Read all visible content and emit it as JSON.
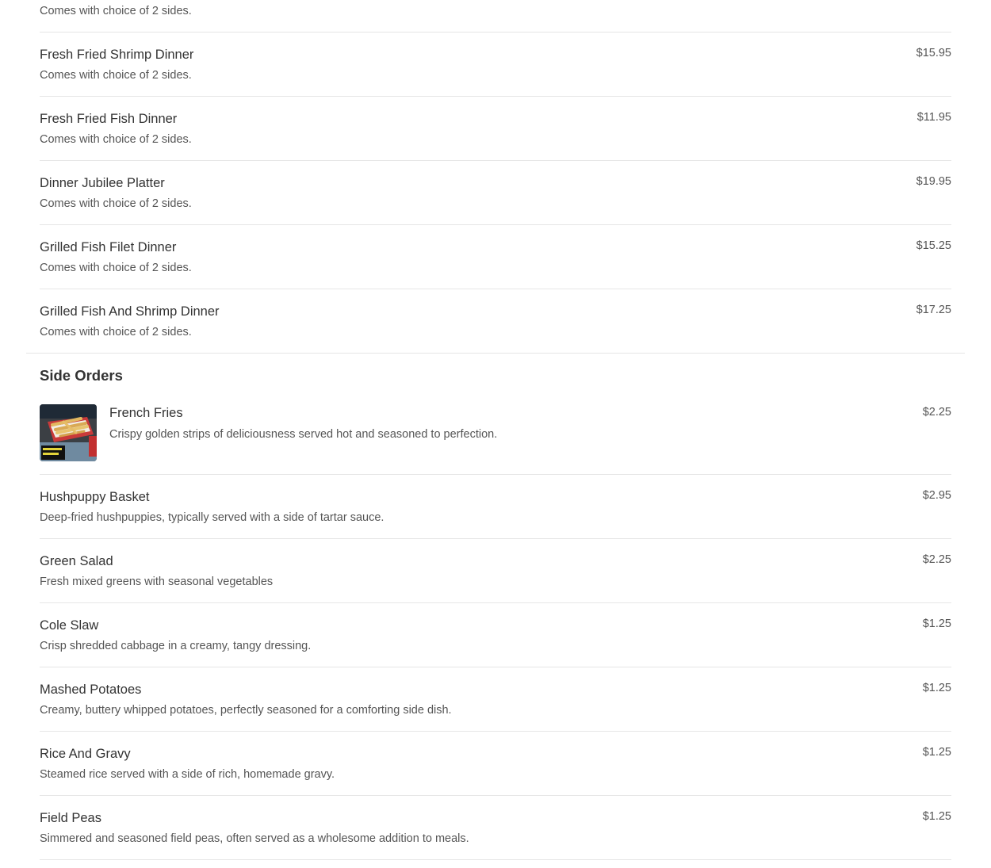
{
  "partial_item": {
    "description": "Comes with choice of 2 sides."
  },
  "dinners": [
    {
      "name": "Fresh Fried Shrimp Dinner",
      "description": "Comes with choice of 2 sides.",
      "price": "$15.95"
    },
    {
      "name": "Fresh Fried Fish Dinner",
      "description": "Comes with choice of 2 sides.",
      "price": "$11.95"
    },
    {
      "name": "Dinner Jubilee Platter",
      "description": "Comes with choice of 2 sides.",
      "price": "$19.95"
    },
    {
      "name": "Grilled Fish Filet Dinner",
      "description": "Comes with choice of 2 sides.",
      "price": "$15.25"
    },
    {
      "name": "Grilled Fish And Shrimp Dinner",
      "description": "Comes with choice of 2 sides.",
      "price": "$17.25"
    }
  ],
  "side_orders": {
    "title": "Side Orders",
    "featured": {
      "name": "French Fries",
      "description": "Crispy golden strips of deliciousness served hot and seasoned to perfection.",
      "price": "$2.25"
    },
    "items": [
      {
        "name": "Hushpuppy Basket",
        "description": "Deep-fried hushpuppies, typically served with a side of tartar sauce.",
        "price": "$2.95"
      },
      {
        "name": "Green Salad",
        "description": "Fresh mixed greens with seasonal vegetables",
        "price": "$2.25"
      },
      {
        "name": "Cole Slaw",
        "description": "Crisp shredded cabbage in a creamy, tangy dressing.",
        "price": "$1.25"
      },
      {
        "name": "Mashed Potatoes",
        "description": "Creamy, buttery whipped potatoes, perfectly seasoned for a comforting side dish.",
        "price": "$1.25"
      },
      {
        "name": "Rice And Gravy",
        "description": "Steamed rice served with a side of rich, homemade gravy.",
        "price": "$1.25"
      },
      {
        "name": "Field Peas",
        "description": "Simmered and seasoned field peas, often served as a wholesome addition to meals.",
        "price": "$1.25"
      }
    ]
  }
}
